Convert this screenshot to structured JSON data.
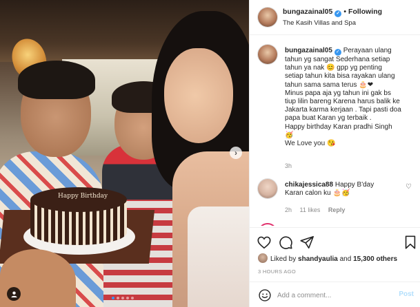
{
  "post": {
    "username": "bungazainal05",
    "follow_status": "Following",
    "separator": "•",
    "location": "The Kasih Villas and Spa",
    "cake_text": "Happy Birthday",
    "carousel": {
      "total": 5,
      "active_index": 0
    }
  },
  "caption": {
    "lines": [
      "Perayaan ulang",
      "tahun yg sangat Sederhana setiap",
      "tahun ya nak 😊 gpp yg penting",
      "setiap tahun kita bisa rayakan ulang",
      "tahun sama sama terus 🎂❤",
      "Minus papa aja yg tahun ini gak bs",
      "tiup lilin bareng Karena harus balik ke",
      "Jakarta karma kerjaan . Tapi pasti doa",
      "papa buat Karan yg terbaik .",
      "Happy birthday Karan pradhi Singh",
      "🥳",
      "We Love you 😘"
    ],
    "time": "3h"
  },
  "comments": [
    {
      "username": "chikajessica88",
      "text_line1": "Happy B'day",
      "text_line2": "Karan calon ku 🎂🥳",
      "time": "2h",
      "likes": "11 likes",
      "reply": "Reply"
    }
  ],
  "footer": {
    "liked_by_prefix": "Liked by",
    "liked_by_user": "shandyaulia",
    "liked_by_and": "and",
    "liked_count": "15,300 others",
    "time_ago": "3 HOURS AGO",
    "add_comment_placeholder": "Add a comment...",
    "post_label": "Post"
  },
  "colors": {
    "verified": "#3897f0",
    "post_button": "#b2dffc",
    "story_ring": "#e1306c"
  },
  "icons": [
    "verified-badge-icon",
    "chevron-right-icon",
    "user-tag-icon",
    "heart-icon",
    "comment-icon",
    "share-icon",
    "bookmark-icon",
    "smile-icon"
  ]
}
